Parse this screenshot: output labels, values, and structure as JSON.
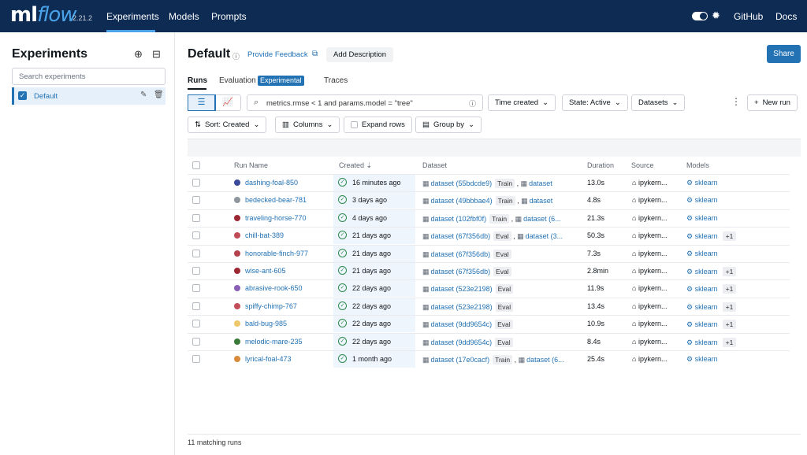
{
  "header": {
    "logo": "mlflow",
    "version": "2.21.2",
    "nav": [
      "Experiments",
      "Models",
      "Prompts"
    ],
    "right_links": [
      "GitHub",
      "Docs"
    ]
  },
  "sidebar": {
    "title": "Experiments",
    "search_placeholder": "Search experiments",
    "items": [
      {
        "label": "Default"
      }
    ]
  },
  "main": {
    "title": "Default",
    "feedback": "Provide Feedback",
    "add_description": "Add Description",
    "share": "Share",
    "tabs": [
      "Runs",
      "Evaluation",
      "Experimental",
      "Traces"
    ],
    "search_value": "metrics.rmse < 1 and params.model = \"tree\"",
    "filters": {
      "time": "Time created",
      "state": "State: Active",
      "datasets": "Datasets"
    },
    "new_run": "New run",
    "toolbar": {
      "sort": "Sort: Created",
      "columns": "Columns",
      "expand": "Expand rows",
      "group": "Group by"
    },
    "columns": [
      "Run Name",
      "Created",
      "Dataset",
      "Duration",
      "Source",
      "Models"
    ],
    "rows": [
      {
        "name": "dashing-foal-850",
        "color": "#3b4a9a",
        "created": "16 minutes ago",
        "dataset": "dataset (55bdcde9)",
        "tag": "Train",
        "extra": "dataset",
        "duration": "13.0s",
        "source": "ipykern...",
        "model": "sklearn",
        "plus": ""
      },
      {
        "name": "bedecked-bear-781",
        "color": "#8f969e",
        "created": "3 days ago",
        "dataset": "dataset (49bbbae4)",
        "tag": "Train",
        "extra": "dataset",
        "duration": "4.8s",
        "source": "ipykern...",
        "model": "sklearn",
        "plus": ""
      },
      {
        "name": "traveling-horse-770",
        "color": "#9b2733",
        "created": "4 days ago",
        "dataset": "dataset (102fbf0f)",
        "tag": "Train",
        "extra": "dataset (6...",
        "duration": "21.3s",
        "source": "ipykern...",
        "model": "sklearn",
        "plus": ""
      },
      {
        "name": "chill-bat-389",
        "color": "#c04a55",
        "created": "21 days ago",
        "dataset": "dataset (67f356db)",
        "tag": "Eval",
        "extra": "dataset (3...",
        "duration": "50.3s",
        "source": "ipykern...",
        "model": "sklearn",
        "plus": "+1"
      },
      {
        "name": "honorable-finch-977",
        "color": "#b4434f",
        "created": "21 days ago",
        "dataset": "dataset (67f356db)",
        "tag": "Eval",
        "extra": "",
        "duration": "7.3s",
        "source": "ipykern...",
        "model": "sklearn",
        "plus": ""
      },
      {
        "name": "wise-ant-605",
        "color": "#9e2832",
        "created": "21 days ago",
        "dataset": "dataset (67f356db)",
        "tag": "Eval",
        "extra": "",
        "duration": "2.8min",
        "source": "ipykern...",
        "model": "sklearn",
        "plus": "+1"
      },
      {
        "name": "abrasive-rook-650",
        "color": "#8a5fb8",
        "created": "22 days ago",
        "dataset": "dataset (523e2198)",
        "tag": "Eval",
        "extra": "",
        "duration": "11.9s",
        "source": "ipykern...",
        "model": "sklearn",
        "plus": "+1"
      },
      {
        "name": "spiffy-chimp-767",
        "color": "#c44d5a",
        "created": "22 days ago",
        "dataset": "dataset (523e2198)",
        "tag": "Eval",
        "extra": "",
        "duration": "13.4s",
        "source": "ipykern...",
        "model": "sklearn",
        "plus": "+1"
      },
      {
        "name": "bald-bug-985",
        "color": "#efc66a",
        "created": "22 days ago",
        "dataset": "dataset (9dd9654c)",
        "tag": "Eval",
        "extra": "",
        "duration": "10.9s",
        "source": "ipykern...",
        "model": "sklearn",
        "plus": "+1"
      },
      {
        "name": "melodic-mare-235",
        "color": "#3a7a3a",
        "created": "22 days ago",
        "dataset": "dataset (9dd9654c)",
        "tag": "Eval",
        "extra": "",
        "duration": "8.4s",
        "source": "ipykern...",
        "model": "sklearn",
        "plus": "+1"
      },
      {
        "name": "lyrical-foal-473",
        "color": "#d98a3a",
        "created": "1 month ago",
        "dataset": "dataset (17e0cacf)",
        "tag": "Train",
        "extra": "dataset (6...",
        "duration": "25.4s",
        "source": "ipykern...",
        "model": "sklearn",
        "plus": ""
      }
    ],
    "footer": "11 matching runs"
  }
}
